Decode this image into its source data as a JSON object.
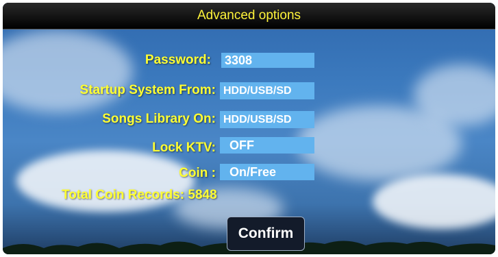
{
  "dialog": {
    "title": "Advanced options",
    "fields": [
      {
        "label": "Password:",
        "value": "3308"
      },
      {
        "label": "Startup System From:",
        "value": "HDD/USB/SD"
      },
      {
        "label": "Songs Library On:",
        "value": "HDD/USB/SD"
      },
      {
        "label": "Lock KTV:",
        "value": "OFF"
      },
      {
        "label": "Coin :",
        "value": "On/Free"
      }
    ],
    "total_label": "Total Coin Records:",
    "total_value": "5848",
    "confirm_label": "Confirm"
  }
}
